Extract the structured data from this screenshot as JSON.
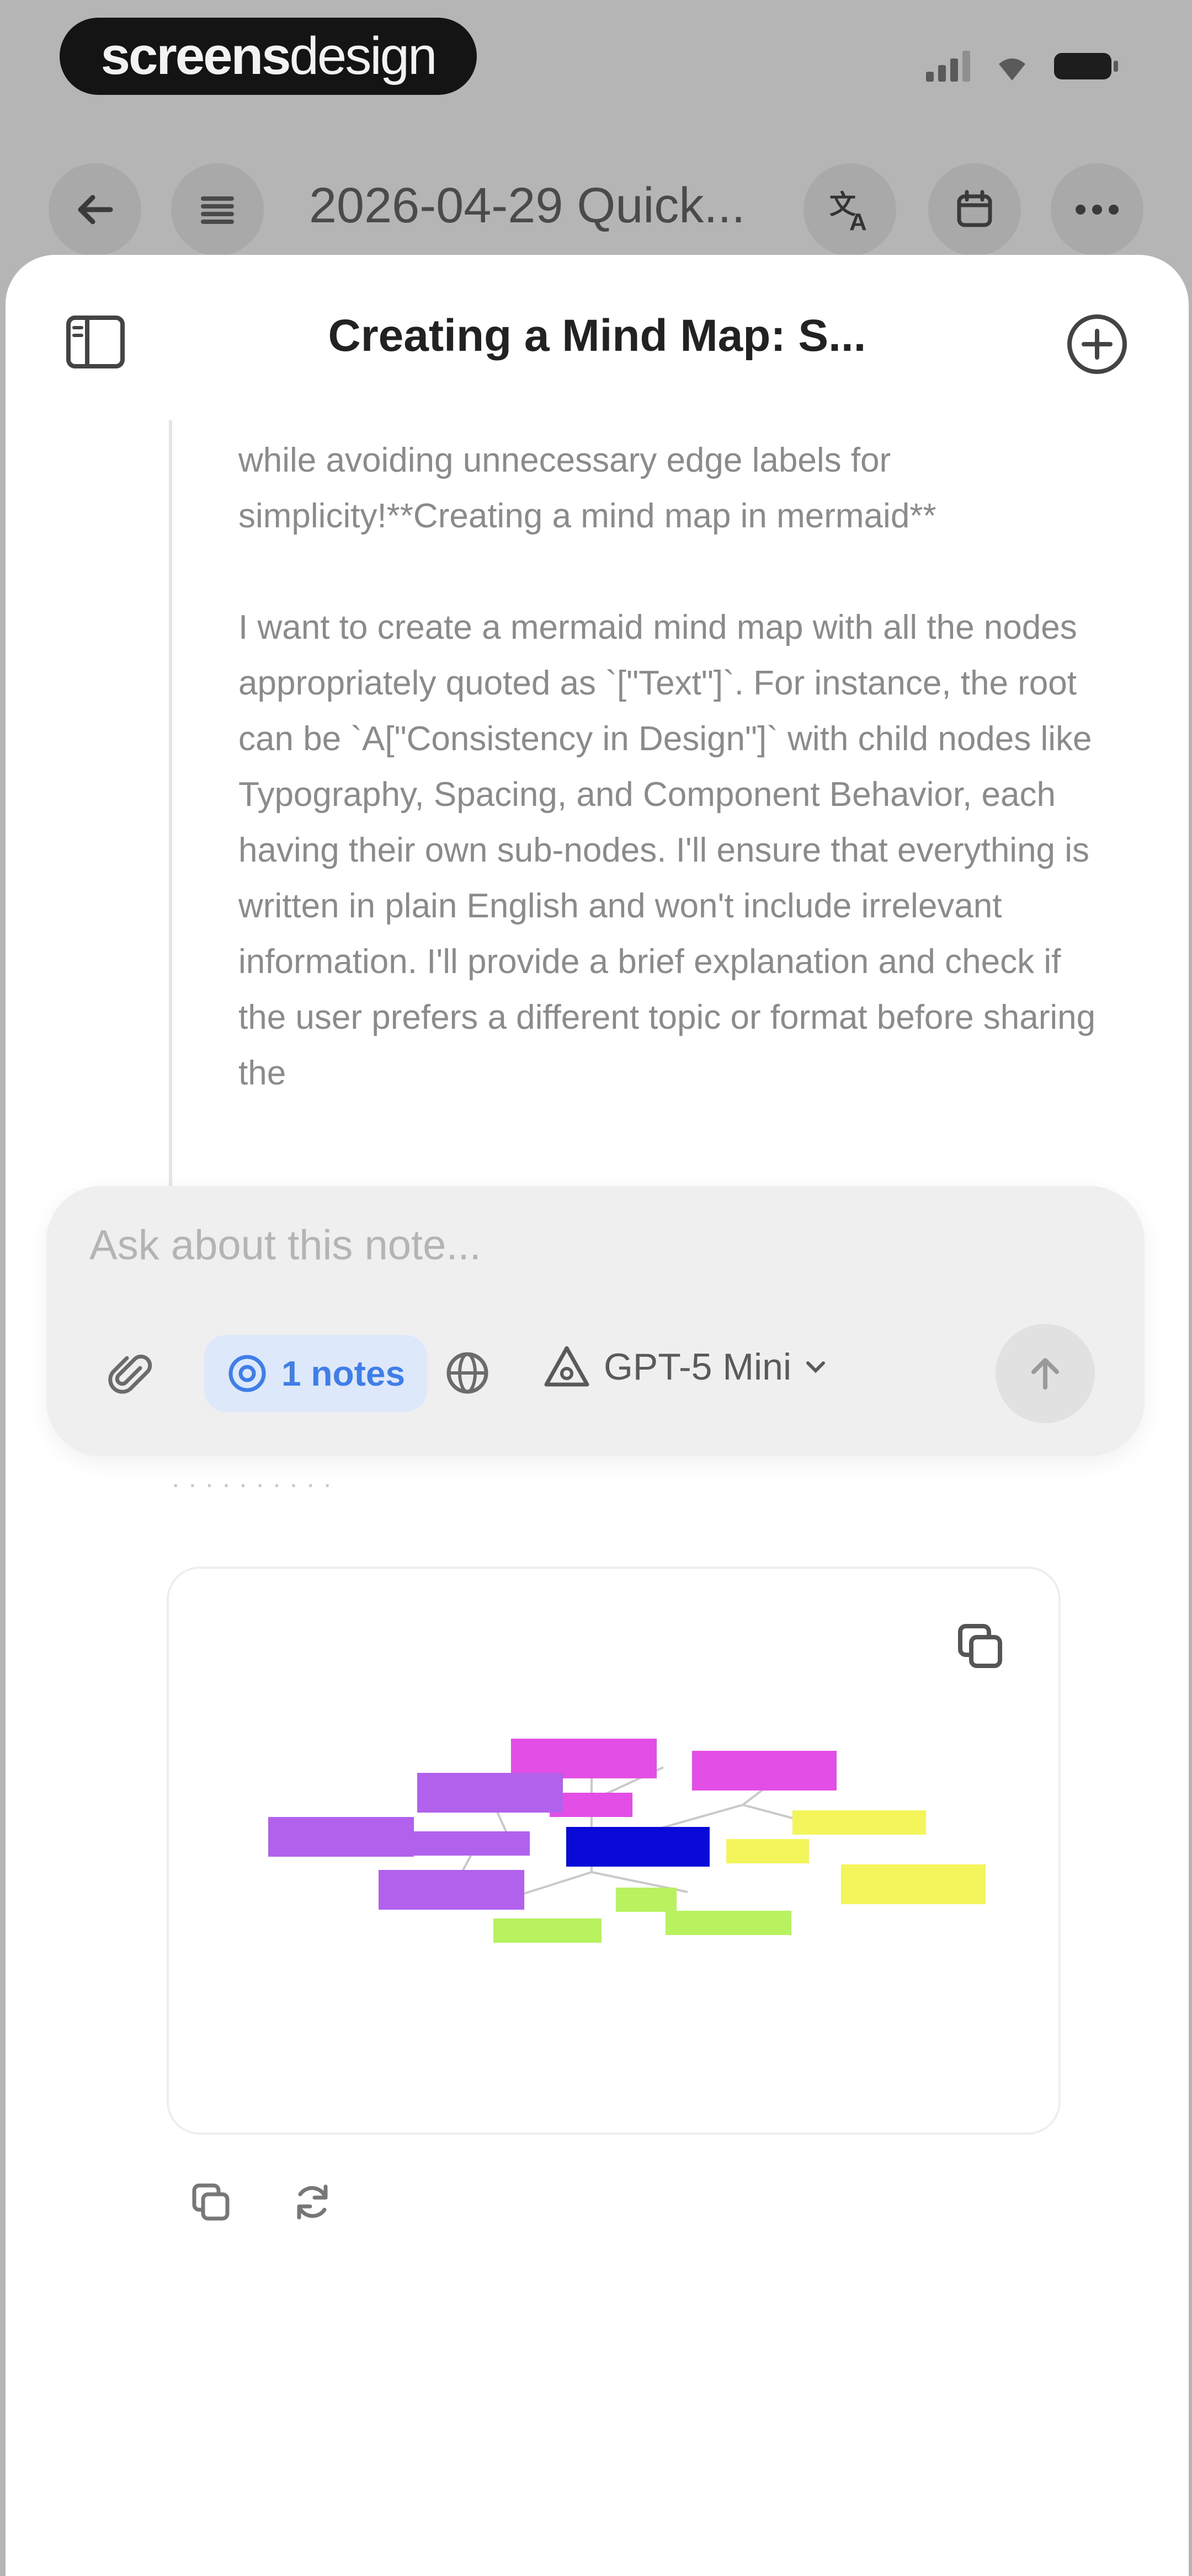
{
  "status_bar": {
    "brand_bold": "screens",
    "brand_light": "design"
  },
  "note_toolbar": {
    "title": "2026-04-29 Quick..."
  },
  "chat": {
    "title": "Creating a Mind Map: S...",
    "reasoning_paragraphs": [
      "while avoiding unnecessary edge labels for simplicity!**Creating a mind map in mermaid**",
      "I want to create a mermaid mind map with all the nodes appropriately quoted as `[\"Text\"]`. For instance, the root can be `A[\"Consistency in Design\"]` with child nodes like Typography, Spacing, and Component Behavior, each having their own sub-nodes. I'll ensure that everything is written in plain English and won't include irrelevant information. I'll provide a brief explanation and check if the user prefers a different topic or format before sharing the"
    ]
  },
  "composer": {
    "placeholder": "Ask about this note...",
    "notes_chip": "1 notes",
    "model": "GPT-5 Mini"
  },
  "colors": {
    "root_node": "#0a0ad8",
    "purple_nodes": "#b161ec",
    "magenta_nodes": "#e34fe6",
    "yellow_nodes": "#f3f55a",
    "green_nodes": "#b8f25f",
    "accent_blue": "#3f7ee8"
  },
  "icons": [
    "back-arrow-icon",
    "menu-icon",
    "translate-icon",
    "calendar-icon",
    "more-icon",
    "sidebar-icon",
    "plus-circle-icon",
    "paperclip-icon",
    "at-icon",
    "globe-icon",
    "model-icon",
    "chevron-down-icon",
    "send-arrow-icon",
    "copy-icon",
    "regenerate-icon"
  ]
}
